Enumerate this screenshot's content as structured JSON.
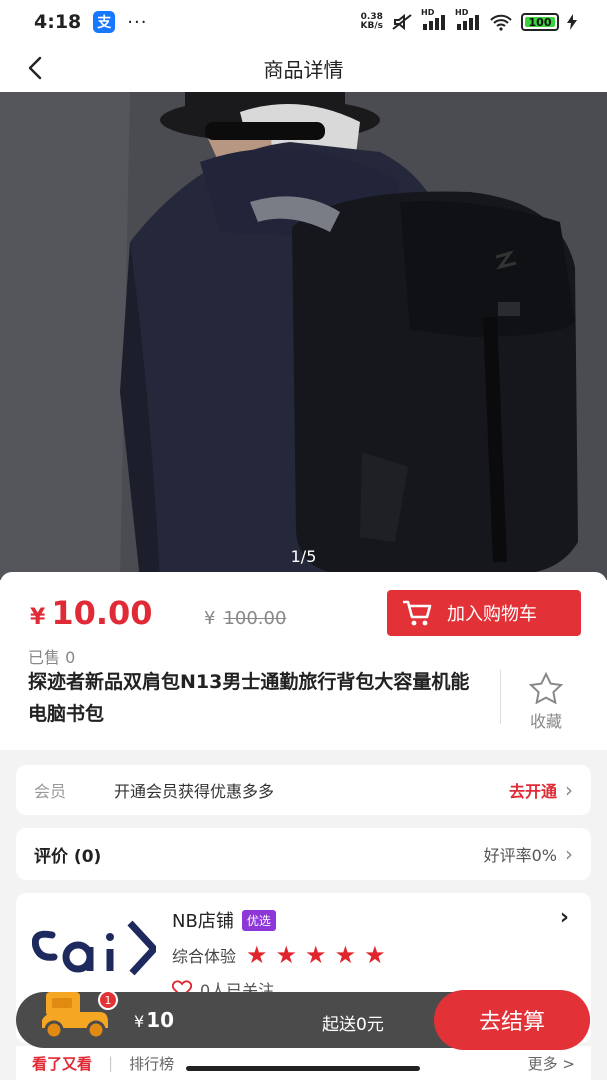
{
  "status": {
    "time": "4:18",
    "alipay": "支",
    "dots": "···",
    "net_speed_value": "0.38",
    "net_speed_unit": "KB/s",
    "hd1": "HD",
    "hd2": "HD",
    "battery": "100"
  },
  "header": {
    "title": "商品详情"
  },
  "gallery": {
    "counter": "1/5"
  },
  "product": {
    "currency": "¥",
    "price": "10.00",
    "original_currency": "¥",
    "original_price": "100.00",
    "add_to_cart": "加入购物车",
    "sold": "已售 0",
    "title": "探迹者新品双肩包N13男士通勤旅行背包大容量机能电脑书包",
    "favorite": "收藏"
  },
  "member": {
    "label": "会员",
    "desc": "开通会员获得优惠多多",
    "action": "去开通"
  },
  "review": {
    "label": "评价 (0)",
    "rate": "好评率0%"
  },
  "shop": {
    "name": "NB店铺",
    "badge": "优选",
    "experience": "综合体验",
    "stars": 5,
    "follow": "0人已关注",
    "star_color": "#e0252c"
  },
  "strip": {
    "hot": "看了又看",
    "rank": "排行榜",
    "more": "更多 >"
  },
  "checkout": {
    "badge_count": "1",
    "currency": "¥",
    "total": "10",
    "min_ship": "起送0元",
    "pay": "去结算"
  },
  "colors": {
    "accent": "#e23238",
    "badge": "#8e37d9"
  }
}
